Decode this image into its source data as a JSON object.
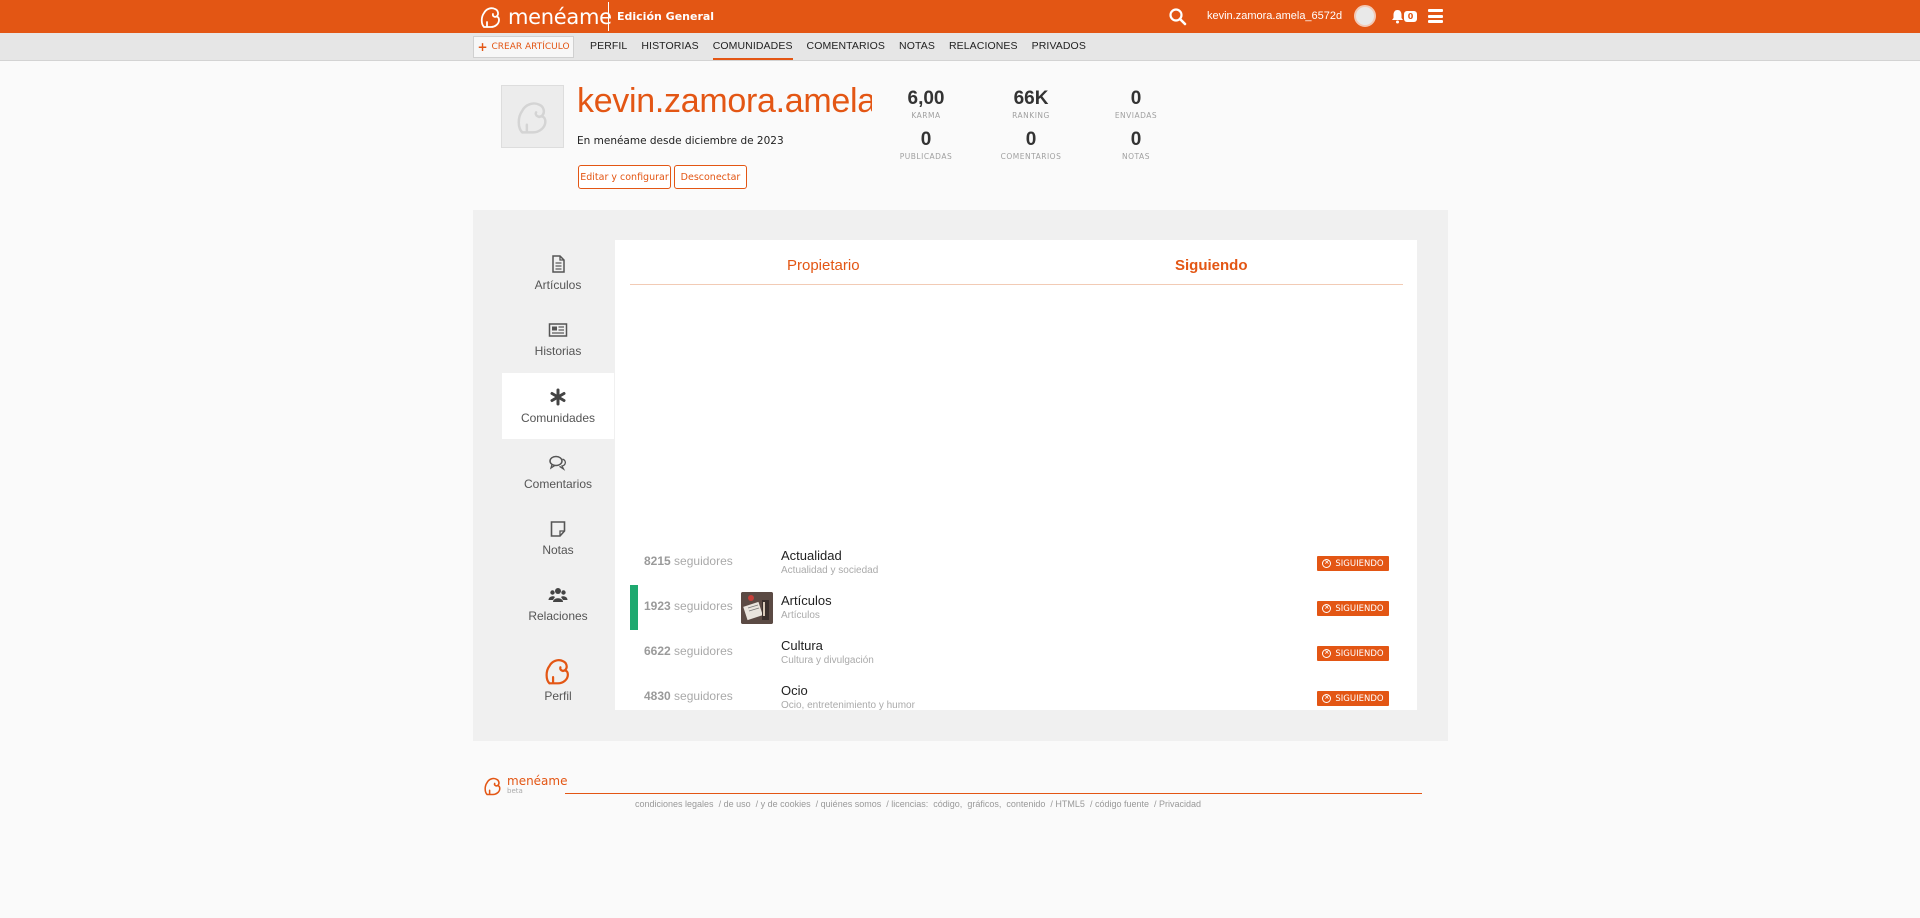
{
  "header": {
    "logo_text": "menéame",
    "edition": "Edición General",
    "username": "kevin.zamora.amela_6572d",
    "notification_count": "0",
    "icons": [
      "logo-icon",
      "search-icon",
      "bell-icon",
      "menu-icon"
    ]
  },
  "subnav": {
    "create_label": "CREAR ARTÍCULO",
    "tabs": [
      "PERFIL",
      "HISTORIAS",
      "COMUNIDADES",
      "COMENTARIOS",
      "NOTAS",
      "RELACIONES",
      "PRIVADOS"
    ],
    "active_tab": "COMUNIDADES"
  },
  "profile": {
    "name": "kevin.zamora.amela_",
    "since": "En menéame desde diciembre de 2023",
    "edit_label": "Editar y configurar",
    "logout_label": "Desconectar",
    "stats": [
      {
        "value": "6,00",
        "label": "KARMA"
      },
      {
        "value": "66K",
        "label": "RANKING"
      },
      {
        "value": "0",
        "label": "ENVIADAS"
      },
      {
        "value": "0",
        "label": "PUBLICADAS"
      },
      {
        "value": "0",
        "label": "COMENTARIOS"
      },
      {
        "value": "0",
        "label": "NOTAS"
      }
    ]
  },
  "sidebar": {
    "items": [
      {
        "label": "Artículos",
        "icon": "document-icon"
      },
      {
        "label": "Historias",
        "icon": "newspaper-icon"
      },
      {
        "label": "Comunidades",
        "icon": "asterisk-icon"
      },
      {
        "label": "Comentarios",
        "icon": "comments-icon"
      },
      {
        "label": "Notas",
        "icon": "note-icon"
      },
      {
        "label": "Relaciones",
        "icon": "users-icon"
      },
      {
        "label": "Perfil",
        "icon": "profile-logo-icon"
      }
    ],
    "active": "Comunidades"
  },
  "content": {
    "tabs": [
      "Propietario",
      "Siguiendo"
    ],
    "active_tab": "Siguiendo",
    "followers_word": "seguidores",
    "follow_label": "SIGUIENDO",
    "communities": [
      {
        "followers": "8215",
        "name": "Actualidad",
        "desc": "Actualidad y sociedad",
        "highlight": false
      },
      {
        "followers": "1923",
        "name": "Artículos",
        "desc": "Artículos",
        "highlight": true
      },
      {
        "followers": "6622",
        "name": "Cultura",
        "desc": "Cultura y divulgación",
        "highlight": false
      },
      {
        "followers": "4830",
        "name": "Ocio",
        "desc": "Ocio, entretenimiento y humor",
        "highlight": false
      }
    ]
  },
  "footer": {
    "logo_text": "menéame",
    "beta": "beta",
    "links": [
      "condiciones legales",
      "/ de uso",
      "/ y de cookies",
      "/ quiénes somos",
      "/ licencias:",
      "código,",
      "gráficos,",
      "contenido",
      "/ HTML5",
      "/ código fuente",
      "/ Privacidad"
    ]
  },
  "colors": {
    "accent": "#e35614",
    "highlight": "#1ea96f",
    "panel": "#f0f0f0"
  }
}
